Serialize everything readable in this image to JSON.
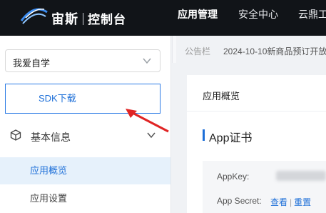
{
  "header": {
    "brand": "宙斯",
    "brand_sub": "控制台",
    "nav": [
      "应用管理",
      "安全中心",
      "云鼎工"
    ]
  },
  "sidebar": {
    "app_select_value": "我爱自学",
    "sdk_button": "SDK下载",
    "group_label": "基本信息",
    "items": [
      "应用概览",
      "应用设置"
    ]
  },
  "notice": {
    "tag": "公告栏",
    "message": "2024-10-10新商品预订开放"
  },
  "main": {
    "breadcrumb": "应用概览",
    "section_title": "App证书",
    "appkey_label": "AppKey:",
    "appsecret_label": "App Secret:",
    "view_link": "查看",
    "reset_link": "重置"
  },
  "colors": {
    "topbar": "#111418",
    "accent": "#1d6fd8",
    "annotation": "#e02424"
  },
  "icons": [
    "zeus-logo",
    "chevron-down-icon",
    "cube-icon",
    "red-arrow-annotation"
  ]
}
